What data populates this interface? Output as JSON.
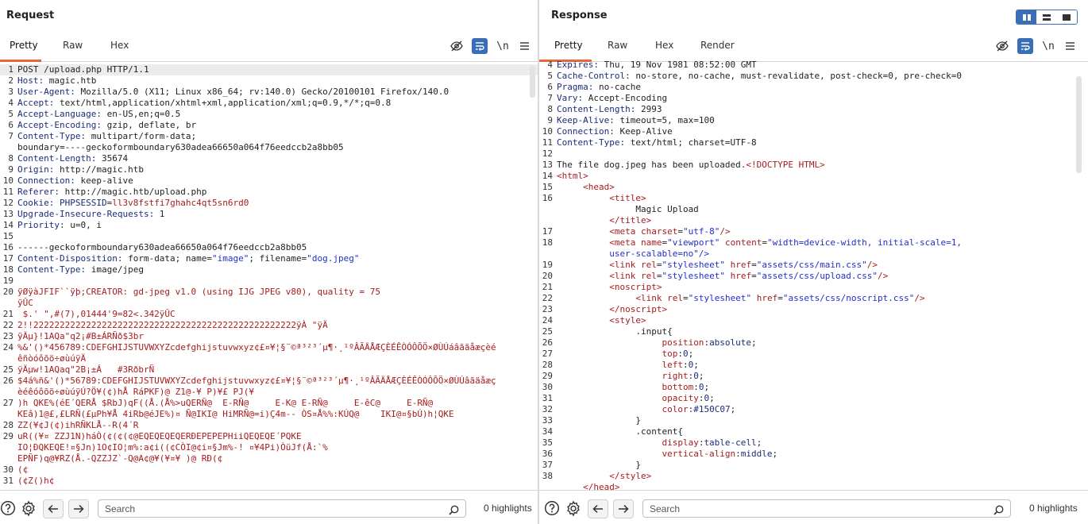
{
  "request": {
    "title": "Request",
    "tabs": [
      "Pretty",
      "Raw",
      "Hex"
    ],
    "newline_label": "\\n",
    "lines": [
      {
        "n": "1",
        "t": "req",
        "k": "",
        "v": "POST /upload.php HTTP/1.1"
      },
      {
        "n": "2",
        "t": "hdr",
        "k": "Host",
        "v": " magic.htb"
      },
      {
        "n": "3",
        "t": "hdr",
        "k": "User-Agent",
        "v": " Mozilla/5.0 (X11; Linux x86_64; rv:140.0) Gecko/20100101 Firefox/140.0"
      },
      {
        "n": "4",
        "t": "hdr",
        "k": "Accept",
        "v": " text/html,application/xhtml+xml,application/xml;q=0.9,*/*;q=0.8"
      },
      {
        "n": "5",
        "t": "hdr",
        "k": "Accept-Language",
        "v": " en-US,en;q=0.5"
      },
      {
        "n": "6",
        "t": "hdr",
        "k": "Accept-Encoding",
        "v": " gzip, deflate, br"
      },
      {
        "n": "7",
        "t": "hdr",
        "k": "Content-Type",
        "v": " multipart/form-data;"
      },
      {
        "n": "",
        "t": "plain",
        "k": "",
        "v": "boundary=----geckoformboundary630adea66650a064f76eedccb2a8bb05"
      },
      {
        "n": "8",
        "t": "hdr",
        "k": "Content-Length",
        "v": " 35674"
      },
      {
        "n": "9",
        "t": "hdr",
        "k": "Origin",
        "v": " http://magic.htb"
      },
      {
        "n": "10",
        "t": "hdr",
        "k": "Connection",
        "v": " keep-alive"
      },
      {
        "n": "11",
        "t": "hdr",
        "k": "Referer",
        "v": " http://magic.htb/upload.php"
      },
      {
        "n": "12",
        "t": "cookie",
        "k": "Cookie",
        "v": "PHPSESSID=ll3v8fstfi7ghahc4qt5sn6rd0"
      },
      {
        "n": "13",
        "t": "hdr",
        "k": "Upgrade-Insecure-Requests",
        "v": " 1"
      },
      {
        "n": "14",
        "t": "hdr",
        "k": "Priority",
        "v": " u=0, i"
      },
      {
        "n": "15",
        "t": "plain",
        "k": "",
        "v": ""
      },
      {
        "n": "16",
        "t": "plain",
        "k": "",
        "v": "------geckoformboundary630adea66650a064f76eedccb2a8bb05"
      },
      {
        "n": "17",
        "t": "cd",
        "k": "Content-Disposition",
        "v": ""
      },
      {
        "n": "18",
        "t": "hdr",
        "k": "Content-Type",
        "v": " image/jpeg"
      },
      {
        "n": "19",
        "t": "plain",
        "k": "",
        "v": ""
      },
      {
        "n": "20",
        "t": "bin",
        "k": "",
        "v": "ÿØÿàJFIF``ÿþ;CREATOR: gd-jpeg v1.0 (using IJG JPEG v80), quality = 75"
      },
      {
        "n": "",
        "t": "bin",
        "k": "",
        "v": "ÿÛC"
      },
      {
        "n": "21",
        "t": "bin",
        "k": "",
        "v": " $.' \",#(7),01444'9=82<.342ÿÛC"
      },
      {
        "n": "22",
        "t": "bin",
        "k": "",
        "v": "2!!22222222222222222222222222222222222222222222222222ÿÀ \"ÿÄ"
      },
      {
        "n": "23",
        "t": "bin",
        "k": "",
        "v": "ÿÄµ}!1AQa\"q2¡#B±ÁRÑð$3br"
      },
      {
        "n": "24",
        "t": "bin",
        "k": "",
        "v": "%&'()*456789:CDEFGHIJSTUVWXYZcdefghijstuvwxyz¢£¤¥¦§¨©ª³²³´µ¶·¸¹ºÂÃÄÅÆÇÈÉÊÒÓÔÕÖ×ØÙÚáâãäåæçèé"
      },
      {
        "n": "",
        "t": "bin",
        "k": "",
        "v": "êñòóôõö÷øùúÿÄ"
      },
      {
        "n": "25",
        "t": "bin",
        "k": "",
        "v": "ÿÄµw!1AQaq\"2B¡±Á   #3RðbrÑ"
      },
      {
        "n": "26",
        "t": "bin",
        "k": "",
        "v": "$4á%ñ&'()*56789:CDEFGHIJSTUVWXYZcdefghijstuvwxyz¢£¤¥¦§¨©ª³²³´µ¶·¸¹ºÂÃÄÅÆÇÈÉÊÒÓÔÕÖ×ØÙÚâãäåæç"
      },
      {
        "n": "",
        "t": "bin",
        "k": "",
        "v": "èéêóôõö÷øùúÿÚ?Ö¥(¢)hÅ RáPKF)@ Z1@-¥ P)¥£ PJ(¥"
      },
      {
        "n": "27",
        "t": "bin",
        "k": "",
        "v": ")h QKE%(éE´QERÅ $RbJ)qF((Å.(Å%>uQERÑ@  E-RÑ@     E-K@ E-RÑ@     E-êC@     E-RÑ@"
      },
      {
        "n": "",
        "t": "bin",
        "k": "",
        "v": "KEâ)1@£,£LRÑ(£µPh¥Å 4iRb@éJE%)¤ Ñ@IKI@ HiMRÑ@=i)Ç4m-- ÒS¤Å%%:KÚQ@    IKI@¤§bÚ)h¦QKE"
      },
      {
        "n": "28",
        "t": "bin",
        "k": "",
        "v": "ZZ(¥¢J(¢)ihRÑKLÅ--R(4´R"
      },
      {
        "n": "29",
        "t": "bin",
        "k": "",
        "v": "uR((¥¤ ZZJ1N)háÒ(¢(¢(¢@EQEQEQEQERÐEPEPEPHiiQEQEQE´PQKE"
      },
      {
        "n": "",
        "t": "bin",
        "k": "",
        "v": "IO¦ÐQKEQE!¤§Jn)1O¢IO¦m%:a¢i((¢CÒI@¢i¤§Jm%-! ¤¥4Pi)ÒüJf(Å:`%"
      },
      {
        "n": "",
        "t": "bin",
        "k": "",
        "v": "EPÑF)q@¥RZ(Å.-QZZJZ`-Q@A¢@¥(¥¤¥ )@ RÐ(¢"
      },
      {
        "n": "30",
        "t": "bin",
        "k": "",
        "v": "(¢"
      },
      {
        "n": "31",
        "t": "bin",
        "k": "",
        "v": "(¢Z()h¢"
      }
    ],
    "cd_parts": {
      "a": " form-data; name=",
      "b": "\"image\"",
      "c": "; filename=",
      "d": "\"dog.jpeg\""
    },
    "search_placeholder": "Search",
    "highlights": "0 highlights"
  },
  "response": {
    "title": "Response",
    "tabs": [
      "Pretty",
      "Raw",
      "Hex",
      "Render"
    ],
    "newline_label": "\\n",
    "lines": [
      {
        "n": "4",
        "t": "hdr",
        "k": "Expires",
        "v": " Thu, 19 Nov 1981 08:52:00 GMT"
      },
      {
        "n": "5",
        "t": "hdr",
        "k": "Cache-Control",
        "v": " no-store, no-cache, must-revalidate, post-check=0, pre-check=0"
      },
      {
        "n": "6",
        "t": "hdr",
        "k": "Pragma",
        "v": " no-cache"
      },
      {
        "n": "7",
        "t": "hdr",
        "k": "Vary",
        "v": " Accept-Encoding"
      },
      {
        "n": "8",
        "t": "hdr",
        "k": "Content-Length",
        "v": " 2993"
      },
      {
        "n": "9",
        "t": "hdr",
        "k": "Keep-Alive",
        "v": " timeout=5, max=100"
      },
      {
        "n": "10",
        "t": "hdr",
        "k": "Connection",
        "v": " Keep-Alive"
      },
      {
        "n": "11",
        "t": "hdr",
        "k": "Content-Type",
        "v": " text/html; charset=UTF-8"
      },
      {
        "n": "12",
        "t": "plain",
        "k": "",
        "v": ""
      },
      {
        "n": "13",
        "t": "mixed",
        "k": "The file dog.jpeg has been uploaded.",
        "v": "<!DOCTYPE HTML>"
      },
      {
        "n": "14",
        "t": "tag",
        "k": "",
        "v": "<html>"
      },
      {
        "n": "15",
        "t": "tag",
        "k": "     ",
        "v": "<head>"
      },
      {
        "n": "16",
        "t": "tag",
        "k": "          ",
        "v": "<title>"
      },
      {
        "n": "",
        "t": "plain",
        "k": "",
        "v": "               Magic Upload"
      },
      {
        "n": "",
        "t": "tag",
        "k": "          ",
        "v": "</title>"
      },
      {
        "n": "17",
        "t": "meta1",
        "k": "          ",
        "v": ""
      },
      {
        "n": "18",
        "t": "meta2",
        "k": "          ",
        "v": ""
      },
      {
        "n": "",
        "t": "cont",
        "k": "",
        "v": "          user-scalable=no\"/>"
      },
      {
        "n": "19",
        "t": "link",
        "k": "          ",
        "v": "assets/css/main.css"
      },
      {
        "n": "20",
        "t": "link",
        "k": "          ",
        "v": "assets/css/upload.css"
      },
      {
        "n": "21",
        "t": "tag",
        "k": "          ",
        "v": "<noscript>"
      },
      {
        "n": "22",
        "t": "link",
        "k": "               ",
        "v": "assets/css/noscript.css"
      },
      {
        "n": "23",
        "t": "tag",
        "k": "          ",
        "v": "</noscript>"
      },
      {
        "n": "24",
        "t": "tag",
        "k": "          ",
        "v": "<style>"
      },
      {
        "n": "25",
        "t": "plain",
        "k": "",
        "v": "               .input{"
      },
      {
        "n": "26",
        "t": "css",
        "k": "position",
        "v": "absolute"
      },
      {
        "n": "27",
        "t": "css",
        "k": "top",
        "v": "0"
      },
      {
        "n": "28",
        "t": "css",
        "k": "left",
        "v": "0"
      },
      {
        "n": "29",
        "t": "css",
        "k": "right",
        "v": "0"
      },
      {
        "n": "30",
        "t": "css",
        "k": "bottom",
        "v": "0"
      },
      {
        "n": "31",
        "t": "css",
        "k": "opacity",
        "v": "0"
      },
      {
        "n": "32",
        "t": "css",
        "k": "color",
        "v": "#150C07"
      },
      {
        "n": "33",
        "t": "plain",
        "k": "",
        "v": "               }"
      },
      {
        "n": "34",
        "t": "plain",
        "k": "",
        "v": "               .content{"
      },
      {
        "n": "35",
        "t": "css",
        "k": "display",
        "v": "table-cell"
      },
      {
        "n": "36",
        "t": "css",
        "k": "vertical-align",
        "v": "middle"
      },
      {
        "n": "37",
        "t": "plain",
        "k": "",
        "v": "               }"
      },
      {
        "n": "38",
        "t": "tag",
        "k": "          ",
        "v": "</style>"
      },
      {
        "n": "",
        "t": "tag",
        "k": "     ",
        "v": "</head>"
      }
    ],
    "meta1": {
      "pre": "<meta ",
      "a1": "charset",
      "eq": "=",
      "v1": "\"utf-8\"",
      "post": "/>"
    },
    "meta2": {
      "pre": "<meta ",
      "a1": "name",
      "v1": "\"viewport\"",
      "a2": "content",
      "v2": "\"width=device-width, initial-scale=1,"
    },
    "link_parts": {
      "pre": "<link ",
      "a1": "rel",
      "v1": "\"stylesheet\"",
      "a2": "href",
      "post": "/>"
    },
    "search_placeholder": "Search",
    "highlights": "0 highlights"
  }
}
